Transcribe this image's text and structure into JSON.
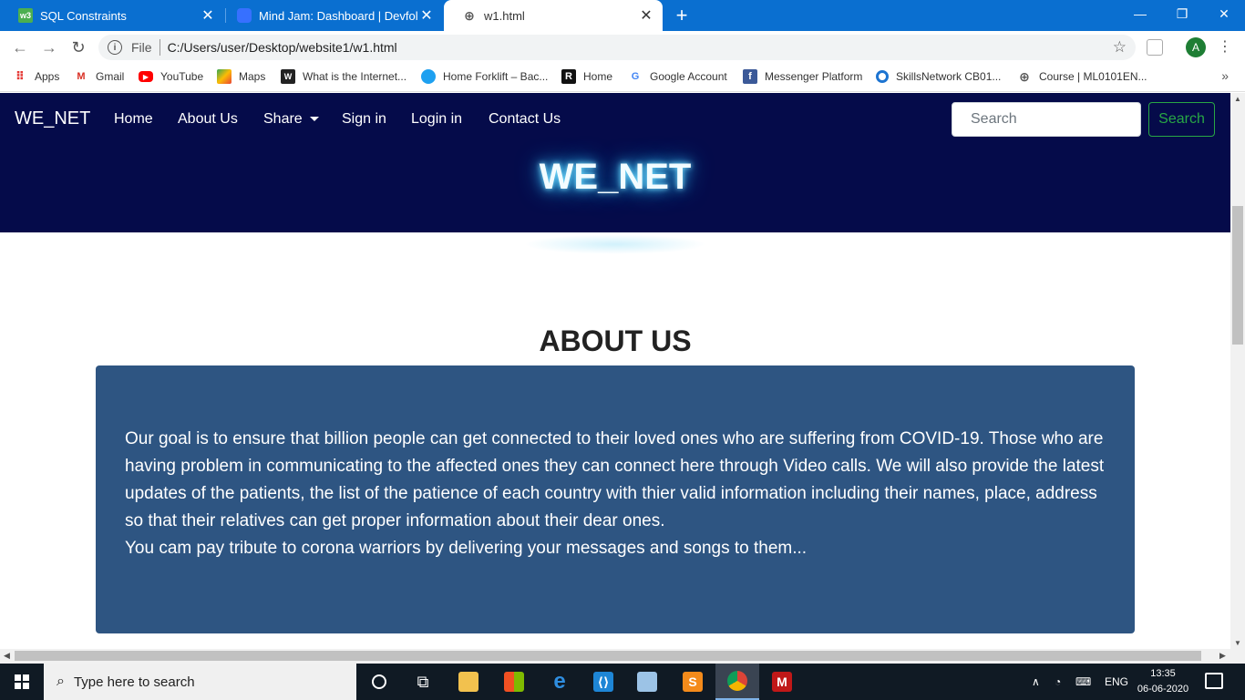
{
  "browser": {
    "tabs": [
      {
        "title": "SQL Constraints",
        "favicon": "w3"
      },
      {
        "title": "Mind Jam: Dashboard | Devfolio",
        "favicon": ""
      },
      {
        "title": "w1.html",
        "favicon": "globe-icon"
      }
    ],
    "new_tab": "+",
    "address": {
      "scheme": "File",
      "url": "C:/Users/user/Desktop/website1/w1.html"
    },
    "profile_initial": "A",
    "bookmarks": [
      {
        "label": "Apps",
        "icon": "apps-grid-icon"
      },
      {
        "label": "Gmail",
        "icon": "M"
      },
      {
        "label": "YouTube",
        "icon": "youtube-icon"
      },
      {
        "label": "Maps",
        "icon": "maps-icon"
      },
      {
        "label": "What is the Internet...",
        "icon": "W"
      },
      {
        "label": "Home Forklift – Bac...",
        "icon": "cloud-icon"
      },
      {
        "label": "Home",
        "icon": "R"
      },
      {
        "label": "Google Account",
        "icon": "G"
      },
      {
        "label": "Messenger Platform",
        "icon": "f"
      },
      {
        "label": "SkillsNetwork CB01...",
        "icon": "O"
      },
      {
        "label": "Course | ML0101EN...",
        "icon": "globe-icon"
      }
    ],
    "bookmarks_more": "»"
  },
  "site": {
    "brand": "WE_NET",
    "nav": {
      "home": "Home",
      "about": "About Us",
      "share": "Share",
      "signin": "Sign in",
      "login": "Login in",
      "contact": "Contact Us"
    },
    "search_placeholder": "Search",
    "search_button": "Search",
    "hero_title": "WE_NET",
    "about_heading": "ABOUT US",
    "about_text": "Our goal is to ensure that billion people can get connected to their loved ones who are suffering from COVID-19. Those who are having problem in communicating to the affected ones they can connect here through Video calls. We will also provide the latest updates of the patients, the list of the patience of each country with thier valid information including their names, place, address so that their relatives can get proper information about their dear ones.",
    "about_text_2": "You cam pay tribute to corona warriors by delivering your messages and songs to them..."
  },
  "taskbar": {
    "search_placeholder": "Type here to search",
    "language": "ENG",
    "time": "13:35",
    "date": "06-06-2020"
  },
  "colors": {
    "navbar": "#050b4a",
    "about_box": "#2e5582",
    "search_button": "#28a745",
    "tabstrip": "#0a6fd0"
  }
}
